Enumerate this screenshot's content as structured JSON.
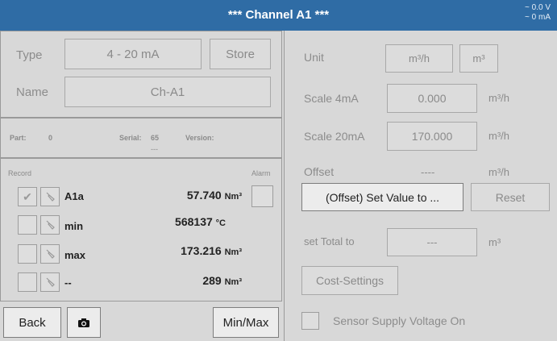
{
  "header": {
    "title": "*** Channel A1 ***",
    "voltage": "~ 0.0 V",
    "current": "~ 0 mA"
  },
  "left": {
    "type_label": "Type",
    "type_value": "4 - 20 mA",
    "store_label": "Store",
    "name_label": "Name",
    "name_value": "Ch-A1",
    "part_label": "Part:",
    "part_value": "0",
    "serial_label": "Serial:",
    "serial_value": "65",
    "serial_sub": "---",
    "version_label": "Version:",
    "record_label": "Record",
    "alarm_label": "Alarm",
    "records": [
      {
        "name": "A1a",
        "value": "57.740",
        "unit": "Nm³",
        "checked": true
      },
      {
        "name": "min",
        "value": "568137",
        "unit": "°C",
        "checked": false
      },
      {
        "name": "max",
        "value": "173.216",
        "unit": "Nm³",
        "checked": false
      },
      {
        "name": "--",
        "value": "289",
        "unit": "Nm³",
        "checked": false
      }
    ],
    "back_label": "Back",
    "minmax_label": "Min/Max"
  },
  "right": {
    "unit_label": "Unit",
    "unit_value": "m³/h",
    "unit_total": "m³",
    "scale4_label": "Scale 4mA",
    "scale4_value": "0.000",
    "scale4_unit": "m³/h",
    "scale20_label": "Scale 20mA",
    "scale20_value": "170.000",
    "scale20_unit": "m³/h",
    "offset_label": "Offset",
    "offset_value": "----",
    "offset_unit": "m³/h",
    "set_value_label": "(Offset) Set Value to ...",
    "reset_label": "Reset",
    "set_total_label": "set Total to",
    "set_total_value": "---",
    "set_total_unit": "m³",
    "cost_label": "Cost-Settings",
    "sensor_supply_label": "Sensor Supply Voltage On"
  }
}
